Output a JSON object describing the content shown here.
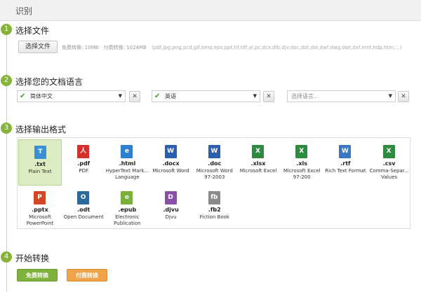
{
  "header": {
    "title": "识别"
  },
  "steps": [
    {
      "number": "1",
      "title": "选择文件"
    },
    {
      "number": "2",
      "title": "选择您的文档语言"
    },
    {
      "number": "3",
      "title": "选择输出格式"
    },
    {
      "number": "4",
      "title": "开始转换"
    }
  ],
  "file": {
    "button_label": "选择文件",
    "free_limit": "免费转换: 10MB",
    "paid_limit": "付费转换: 1024MB",
    "supported_formats": "(pdf,jpg,png,pcd,gif,bmp,eps,ppt,tif,tiff,ai,pc,dcx,dib,djv,doc,dot,dst,dwf,dwg,dwt,dxf,emf,hdp,htm,...)"
  },
  "languages": [
    {
      "value": "简体中文",
      "checked": true
    },
    {
      "value": "英语",
      "checked": true
    },
    {
      "value": "",
      "placeholder": "选择语言..",
      "checked": false
    }
  ],
  "clear_glyph": "✕",
  "formats": [
    {
      "ext": ".txt",
      "desc": "Plain Text",
      "icon": "txt-file-icon",
      "color": "#3b8fd6",
      "letter": "T",
      "selected": true
    },
    {
      "ext": ".pdf",
      "desc": "PDF",
      "icon": "pdf-file-icon",
      "color": "#d4302b",
      "letter": "人",
      "selected": false
    },
    {
      "ext": ".html",
      "desc": "HyperText Mark... Language",
      "icon": "html-file-icon",
      "color": "#2f7fd0",
      "letter": "e",
      "selected": false
    },
    {
      "ext": ".docx",
      "desc": "Microsoft Word",
      "icon": "word-file-icon",
      "color": "#2b5fb0",
      "letter": "W",
      "selected": false
    },
    {
      "ext": ".doc",
      "desc": "Microsoft Word 97-2003",
      "icon": "word-file-icon",
      "color": "#2b5fb0",
      "letter": "W",
      "selected": false
    },
    {
      "ext": ".xlsx",
      "desc": "Microsoft Excel",
      "icon": "excel-file-icon",
      "color": "#2d8a3e",
      "letter": "X",
      "selected": false
    },
    {
      "ext": ".xls",
      "desc": "Microsoft Excel 97-200",
      "icon": "excel-file-icon",
      "color": "#2d8a3e",
      "letter": "X",
      "selected": false
    },
    {
      "ext": ".rtf",
      "desc": "Rich Text Format",
      "icon": "rtf-file-icon",
      "color": "#3a78c4",
      "letter": "W",
      "selected": false
    },
    {
      "ext": ".csv",
      "desc": "Comma-Separ... Values",
      "icon": "csv-file-icon",
      "color": "#2d8a3e",
      "letter": "X",
      "selected": false
    },
    {
      "ext": ".pptx",
      "desc": "Microsoft PowerPoint",
      "icon": "powerpoint-file-icon",
      "color": "#d24726",
      "letter": "P",
      "selected": false
    },
    {
      "ext": ".odt",
      "desc": "Open Document",
      "icon": "odt-file-icon",
      "color": "#2a6a9a",
      "letter": "O",
      "selected": false
    },
    {
      "ext": ".epub",
      "desc": "Electronic Publication",
      "icon": "epub-file-icon",
      "color": "#7ab03a",
      "letter": "e",
      "selected": false
    },
    {
      "ext": ".djvu",
      "desc": "Djvu",
      "icon": "djvu-file-icon",
      "color": "#8a4fa8",
      "letter": "D",
      "selected": false
    },
    {
      "ext": ".fb2",
      "desc": "Fiction Book",
      "icon": "fb2-file-icon",
      "color": "#8a8a8a",
      "letter": "fb",
      "selected": false
    }
  ],
  "buttons": {
    "free": "免费转换",
    "paid": "付费转换"
  }
}
